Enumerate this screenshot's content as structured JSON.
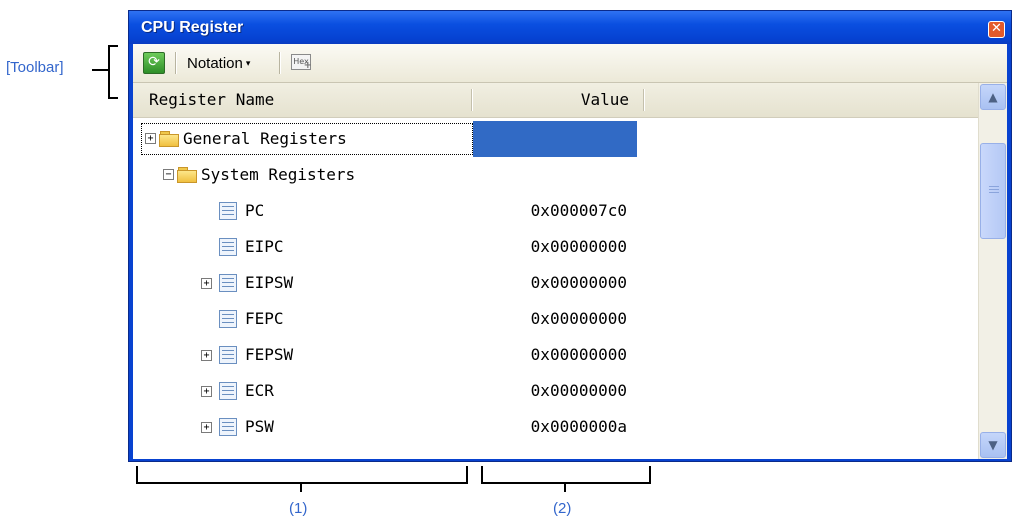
{
  "annotations": {
    "toolbar_label": "[Toolbar]",
    "area1_label": "(1)",
    "area2_label": "(2)"
  },
  "window": {
    "title": "CPU Register",
    "close_glyph": "✕"
  },
  "toolbar": {
    "refresh_icon": "refresh-icon",
    "notation_label": "Notation",
    "notation_arrow": "▾",
    "hex_icon_text": "Hex"
  },
  "columns": {
    "name_header": "Register Name",
    "value_header": "Value"
  },
  "rows": [
    {
      "name": "General Registers",
      "value": "",
      "icon": "folder-icon",
      "expander": "+"
    },
    {
      "name": "System Registers",
      "value": "",
      "icon": "folder-icon",
      "expander": "−"
    },
    {
      "name": "PC",
      "value": "0x000007c0",
      "icon": "register-icon",
      "expander": ""
    },
    {
      "name": "EIPC",
      "value": "0x00000000",
      "icon": "register-icon",
      "expander": ""
    },
    {
      "name": "EIPSW",
      "value": "0x00000000",
      "icon": "register-icon",
      "expander": "+"
    },
    {
      "name": "FEPC",
      "value": "0x00000000",
      "icon": "register-icon",
      "expander": ""
    },
    {
      "name": "FEPSW",
      "value": "0x00000000",
      "icon": "register-icon",
      "expander": "+"
    },
    {
      "name": "ECR",
      "value": "0x00000000",
      "icon": "register-icon",
      "expander": "+"
    },
    {
      "name": "PSW",
      "value": "0x0000000a",
      "icon": "register-icon",
      "expander": "+"
    }
  ],
  "scrollbar": {
    "up_arrow": "▲",
    "down_arrow": "▼"
  },
  "colors": {
    "title_bar": "#0a4fe0",
    "selection": "#316ac5",
    "annotation_text": "#3366cc"
  }
}
